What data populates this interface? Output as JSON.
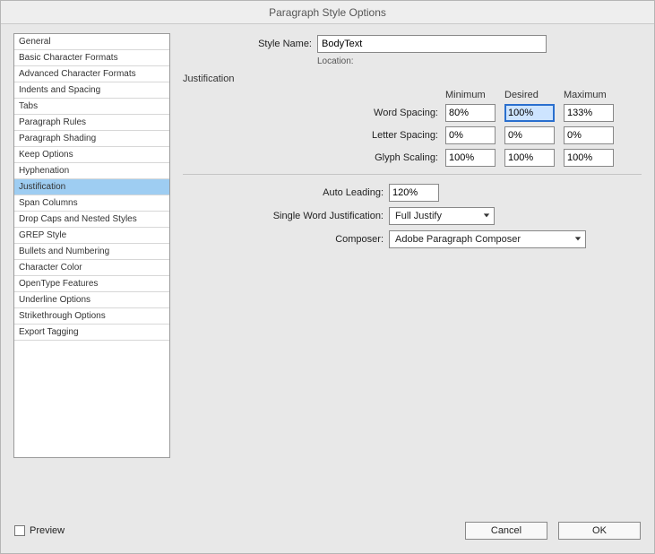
{
  "window": {
    "title": "Paragraph Style Options"
  },
  "sidebar": {
    "items": [
      "General",
      "Basic Character Formats",
      "Advanced Character Formats",
      "Indents and Spacing",
      "Tabs",
      "Paragraph Rules",
      "Paragraph Shading",
      "Keep Options",
      "Hyphenation",
      "Justification",
      "Span Columns",
      "Drop Caps and Nested Styles",
      "GREP Style",
      "Bullets and Numbering",
      "Character Color",
      "OpenType Features",
      "Underline Options",
      "Strikethrough Options",
      "Export Tagging"
    ],
    "selected_index": 9
  },
  "header": {
    "style_name_label": "Style Name:",
    "style_name_value": "BodyText",
    "location_label": "Location:"
  },
  "section": {
    "title": "Justification"
  },
  "grid": {
    "columns": {
      "min": "Minimum",
      "des": "Desired",
      "max": "Maximum"
    },
    "rows": [
      {
        "label": "Word Spacing:",
        "min": "80%",
        "des": "100%",
        "max": "133%"
      },
      {
        "label": "Letter Spacing:",
        "min": "0%",
        "des": "0%",
        "max": "0%"
      },
      {
        "label": "Glyph Scaling:",
        "min": "100%",
        "des": "100%",
        "max": "100%"
      }
    ],
    "focused": {
      "row": 0,
      "col": "des"
    }
  },
  "lower": {
    "auto_leading_label": "Auto Leading:",
    "auto_leading_value": "120%",
    "swj_label": "Single Word Justification:",
    "swj_value": "Full Justify",
    "composer_label": "Composer:",
    "composer_value": "Adobe Paragraph Composer"
  },
  "footer": {
    "preview_label": "Preview",
    "preview_checked": false,
    "cancel": "Cancel",
    "ok": "OK"
  }
}
